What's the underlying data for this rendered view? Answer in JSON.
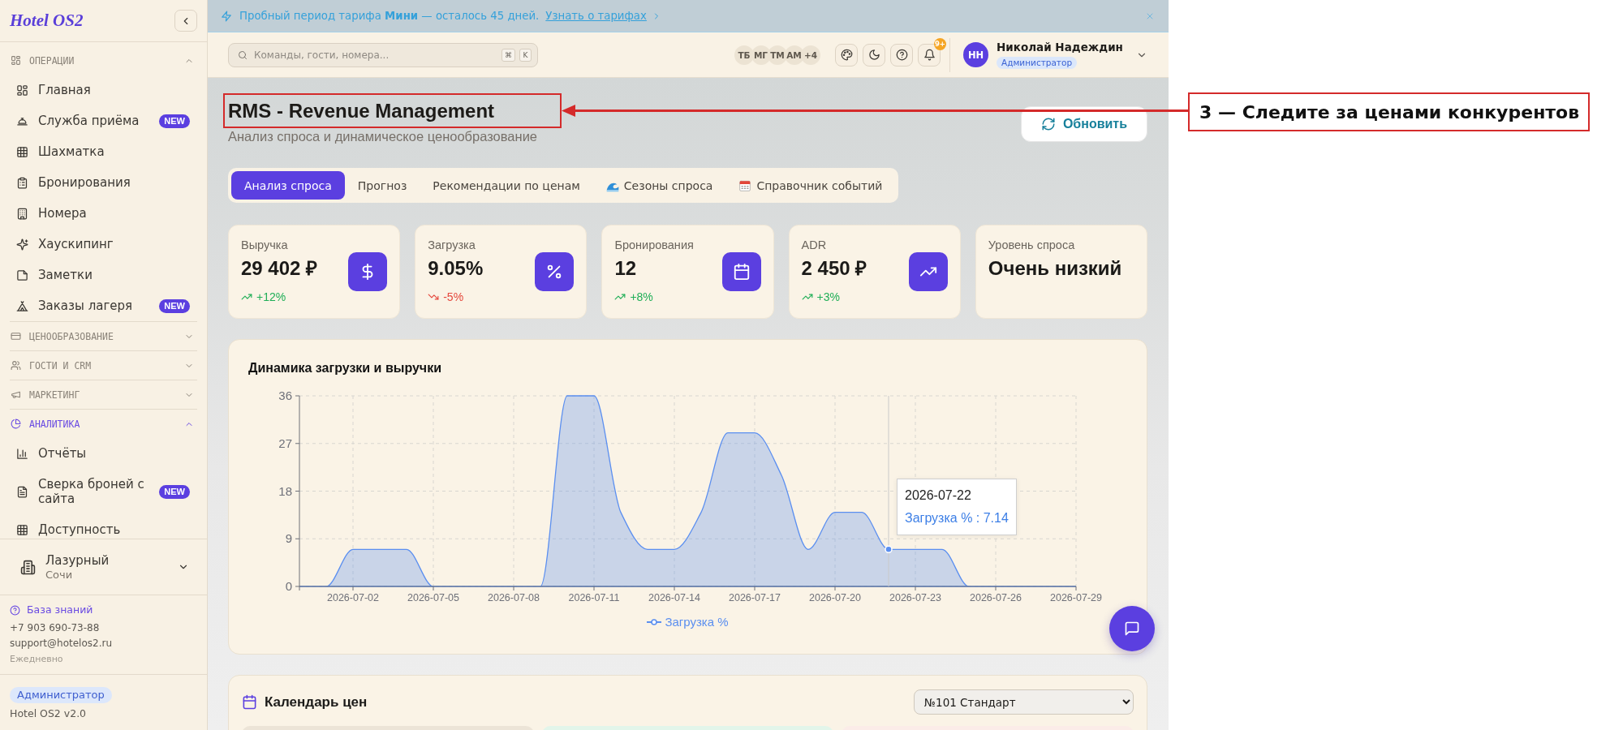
{
  "banner": {
    "text": "Пробный период тарифа **Мини** — осталось 45 дней.",
    "link": "Узнать о тарифах"
  },
  "sidebar": {
    "logo": "Hotel OS2",
    "sections": [
      {
        "title": "ОПЕРАЦИИ",
        "active": false,
        "expanded": true,
        "items": [
          {
            "label": "Главная",
            "selected": false
          },
          {
            "label": "Служба приёма",
            "badge": "NEW",
            "selected": false
          },
          {
            "label": "Шахматка",
            "selected": false
          },
          {
            "label": "Бронирования",
            "selected": false
          },
          {
            "label": "Номера",
            "selected": false
          },
          {
            "label": "Хаускипинг",
            "selected": false
          },
          {
            "label": "Заметки",
            "selected": false
          },
          {
            "label": "Заказы лагеря",
            "badge": "NEW",
            "selected": false
          }
        ]
      },
      {
        "title": "ЦЕНООБРАЗОВАНИЕ",
        "active": false,
        "expanded": false
      },
      {
        "title": "ГОСТИ И CRM",
        "active": false,
        "expanded": false
      },
      {
        "title": "МАРКЕТИНГ",
        "active": false,
        "expanded": false
      },
      {
        "title": "АНАЛИТИКА",
        "active": true,
        "expanded": true,
        "items": [
          {
            "label": "Отчёты",
            "selected": false
          },
          {
            "label": "Сверка броней с сайта",
            "badge": "NEW",
            "selected": false
          },
          {
            "label": "Доступность",
            "selected": false
          }
        ]
      }
    ],
    "hotel": {
      "name": "Лазурный",
      "city": "Сочи"
    },
    "support": {
      "link": "База знаний",
      "phone": "+7 903 690-73-88",
      "email": "support@hotelos2.ru",
      "hours": "Ежедневно"
    },
    "role": "Администратор",
    "version": "Hotel OS2 v2.0"
  },
  "topbar": {
    "search": {
      "placeholder": "Команды, гости, номера...",
      "keys": [
        "⌘",
        "K"
      ]
    },
    "team": [
      "ТБ",
      "МГ",
      "ТМ",
      "АМ"
    ],
    "team_more": "+4",
    "notifications": "9+",
    "user": {
      "initials": "НН",
      "name": "Николай Надеждин",
      "role": "Администратор"
    }
  },
  "header": {
    "title": "RMS - Revenue Management",
    "subtitle": "Анализ спроса и динамическое ценообразование",
    "refresh": "Обновить"
  },
  "tabs": [
    {
      "label": "Анализ спроса",
      "selected": true
    },
    {
      "label": "Прогноз",
      "selected": false
    },
    {
      "label": "Рекомендации по ценам",
      "selected": false
    },
    {
      "label": "Сезоны спроса",
      "selected": false
    },
    {
      "label": "Справочник событий",
      "selected": false
    }
  ],
  "stats": [
    {
      "label": "Выручка",
      "value": "29 402 ₽",
      "delta": "+12%",
      "negative": false
    },
    {
      "label": "Загрузка",
      "value": "9.05%",
      "delta": "-5%",
      "negative": true
    },
    {
      "label": "Бронирования",
      "value": "12",
      "delta": "+8%",
      "negative": false
    },
    {
      "label": "ADR",
      "value": "2 450 ₽",
      "delta": "+3%",
      "negative": false
    },
    {
      "label": "Уровень спроса",
      "value": "Очень низкий"
    }
  ],
  "chart": {
    "title": "Динамика загрузки и выручки",
    "chart_data": {
      "type": "area",
      "grid": true,
      "categories": [
        null,
        null,
        "2026-07-02",
        null,
        null,
        "2026-07-05",
        null,
        null,
        "2026-07-08",
        null,
        null,
        "2026-07-11",
        null,
        null,
        "2026-07-14",
        null,
        null,
        "2026-07-17",
        null,
        null,
        "2026-07-20",
        null,
        null,
        "2026-07-23",
        null,
        null,
        "2026-07-26",
        null,
        null,
        "2026-07-29"
      ],
      "series": [
        {
          "name": "Загрузка %",
          "color": "#5b8ff0",
          "values": [
            0,
            0,
            7,
            7,
            7,
            0,
            0,
            0,
            0,
            0,
            36,
            36,
            14,
            7,
            7,
            14,
            29,
            29,
            21,
            7,
            14,
            14,
            7,
            7,
            7,
            0,
            0,
            0,
            0,
            0
          ]
        }
      ],
      "ylim": [
        0,
        36
      ],
      "yticks": [
        0,
        9,
        18,
        27,
        36
      ],
      "annotations": [
        "2026-07-22",
        "Загрузка % : 7.14"
      ]
    }
  },
  "calendar": {
    "title": "Календарь цен",
    "room": "№101 Стандарт"
  },
  "callout": {
    "text": "3 — Следите за ценами конкурентов"
  }
}
